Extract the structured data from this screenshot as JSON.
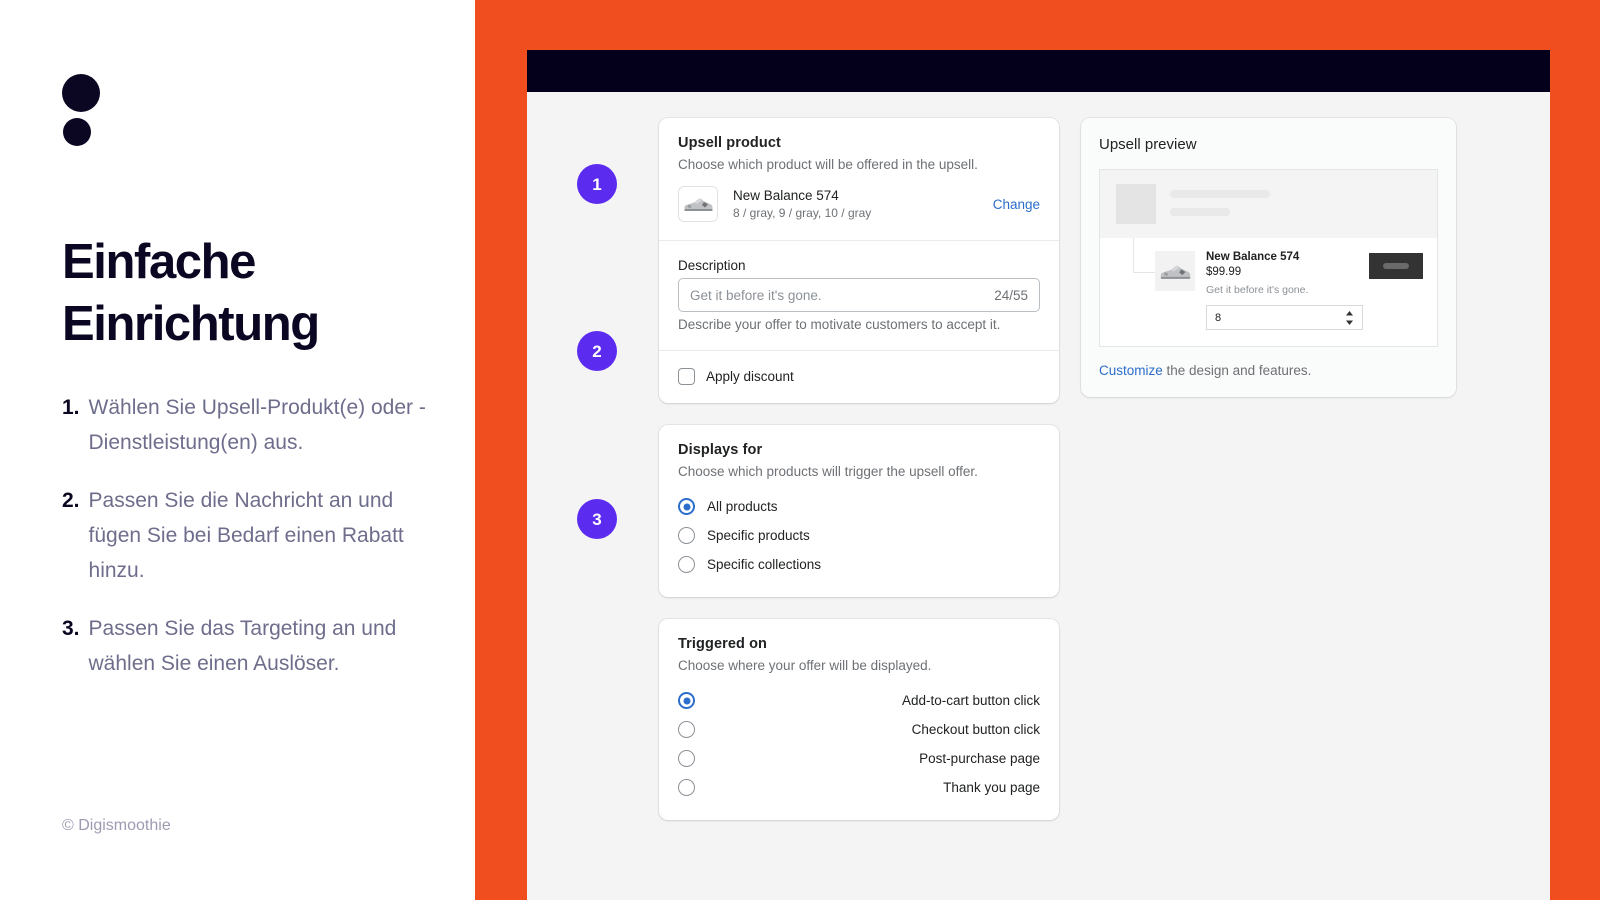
{
  "promo": {
    "title_line1": "Einfache",
    "title_line2": "Einrichtung",
    "steps": [
      {
        "num": "1.",
        "text": "Wählen Sie Upsell-Produkt(e) oder -Dienstleistung(en) aus."
      },
      {
        "num": "2.",
        "text": "Passen Sie die Nachricht an und fügen Sie bei Bedarf einen Rabatt hinzu."
      },
      {
        "num": "3.",
        "text": "Passen Sie das Targeting an und wählen Sie einen Auslöser."
      }
    ],
    "copyright": "© Digismoothie"
  },
  "steps_rail": [
    "1",
    "2",
    "3"
  ],
  "colors": {
    "orange": "#F04E1E",
    "dark_navy": "#04001C",
    "purple_badge": "#5B2BF0",
    "link_blue": "#2C6ECB",
    "app_bg": "#F4F4F5"
  },
  "upsell_product_card": {
    "title": "Upsell product",
    "subtitle": "Choose which product will be offered in the upsell.",
    "product": {
      "name": "New Balance 574",
      "variants": "8 / gray, 9 / gray, 10 / gray",
      "change_label": "Change",
      "thumbnail_icon": "sneaker-icon"
    },
    "description": {
      "label": "Description",
      "value": "Get it before it's gone.",
      "placeholder": "Get it before it's gone.",
      "counter": "24/55",
      "help": "Describe your offer to motivate customers to accept it."
    },
    "apply_discount": {
      "label": "Apply discount",
      "checked": false
    }
  },
  "displays_for_card": {
    "title": "Displays for",
    "subtitle": "Choose which products will trigger the upsell offer.",
    "options": [
      {
        "label": "All products",
        "selected": true
      },
      {
        "label": "Specific products",
        "selected": false
      },
      {
        "label": "Specific collections",
        "selected": false
      }
    ]
  },
  "triggered_on_card": {
    "title": "Triggered on",
    "subtitle": "Choose where your offer will be displayed.",
    "options": [
      {
        "label": "Add-to-cart button click",
        "selected": true
      },
      {
        "label": "Checkout button click",
        "selected": false
      },
      {
        "label": "Post-purchase page",
        "selected": false
      },
      {
        "label": "Thank you page",
        "selected": false
      }
    ]
  },
  "upsell_preview_card": {
    "title": "Upsell preview",
    "product": {
      "name": "New Balance 574",
      "price": "$99.99",
      "description": "Get it before it's gone.",
      "quantity": "8"
    },
    "footer_link": "Customize",
    "footer_text": " the design and features."
  }
}
